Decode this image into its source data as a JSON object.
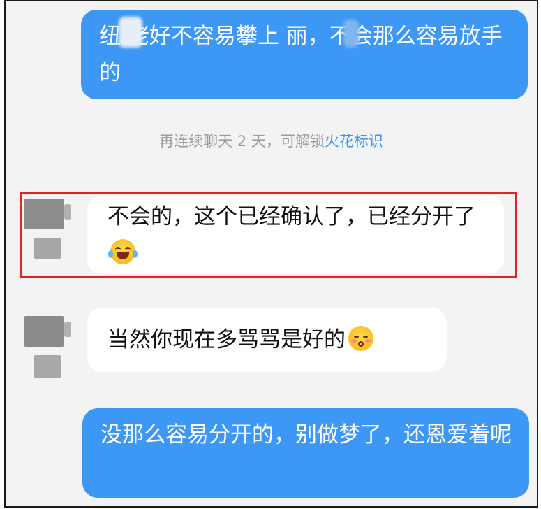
{
  "messages": [
    {
      "direction": "outgoing",
      "text": "纽 佬好不容易攀上 丽，不会那么容易放手的"
    },
    {
      "direction": "incoming",
      "text": "不会的，这个已经确认了，已经分开了",
      "emoji": "laughing-with-tears",
      "highlighted": true
    },
    {
      "direction": "incoming",
      "text": "当然你现在多骂骂是好的",
      "emoji": "blushing-kiss"
    },
    {
      "direction": "outgoing",
      "text": "没那么容易分开的，别做梦了，还恩爱着呢"
    }
  ],
  "system_tip": {
    "prefix": "再连续聊天 2 天，可解锁",
    "spark_label": "火花标识"
  },
  "colors": {
    "outgoing_bubble": "#3d97f4",
    "incoming_bubble": "#ffffff",
    "highlight_border": "#e02424",
    "system_text": "#9c9c9c",
    "spark_text": "#3d97f4",
    "chat_background": "#f3f3f3"
  }
}
